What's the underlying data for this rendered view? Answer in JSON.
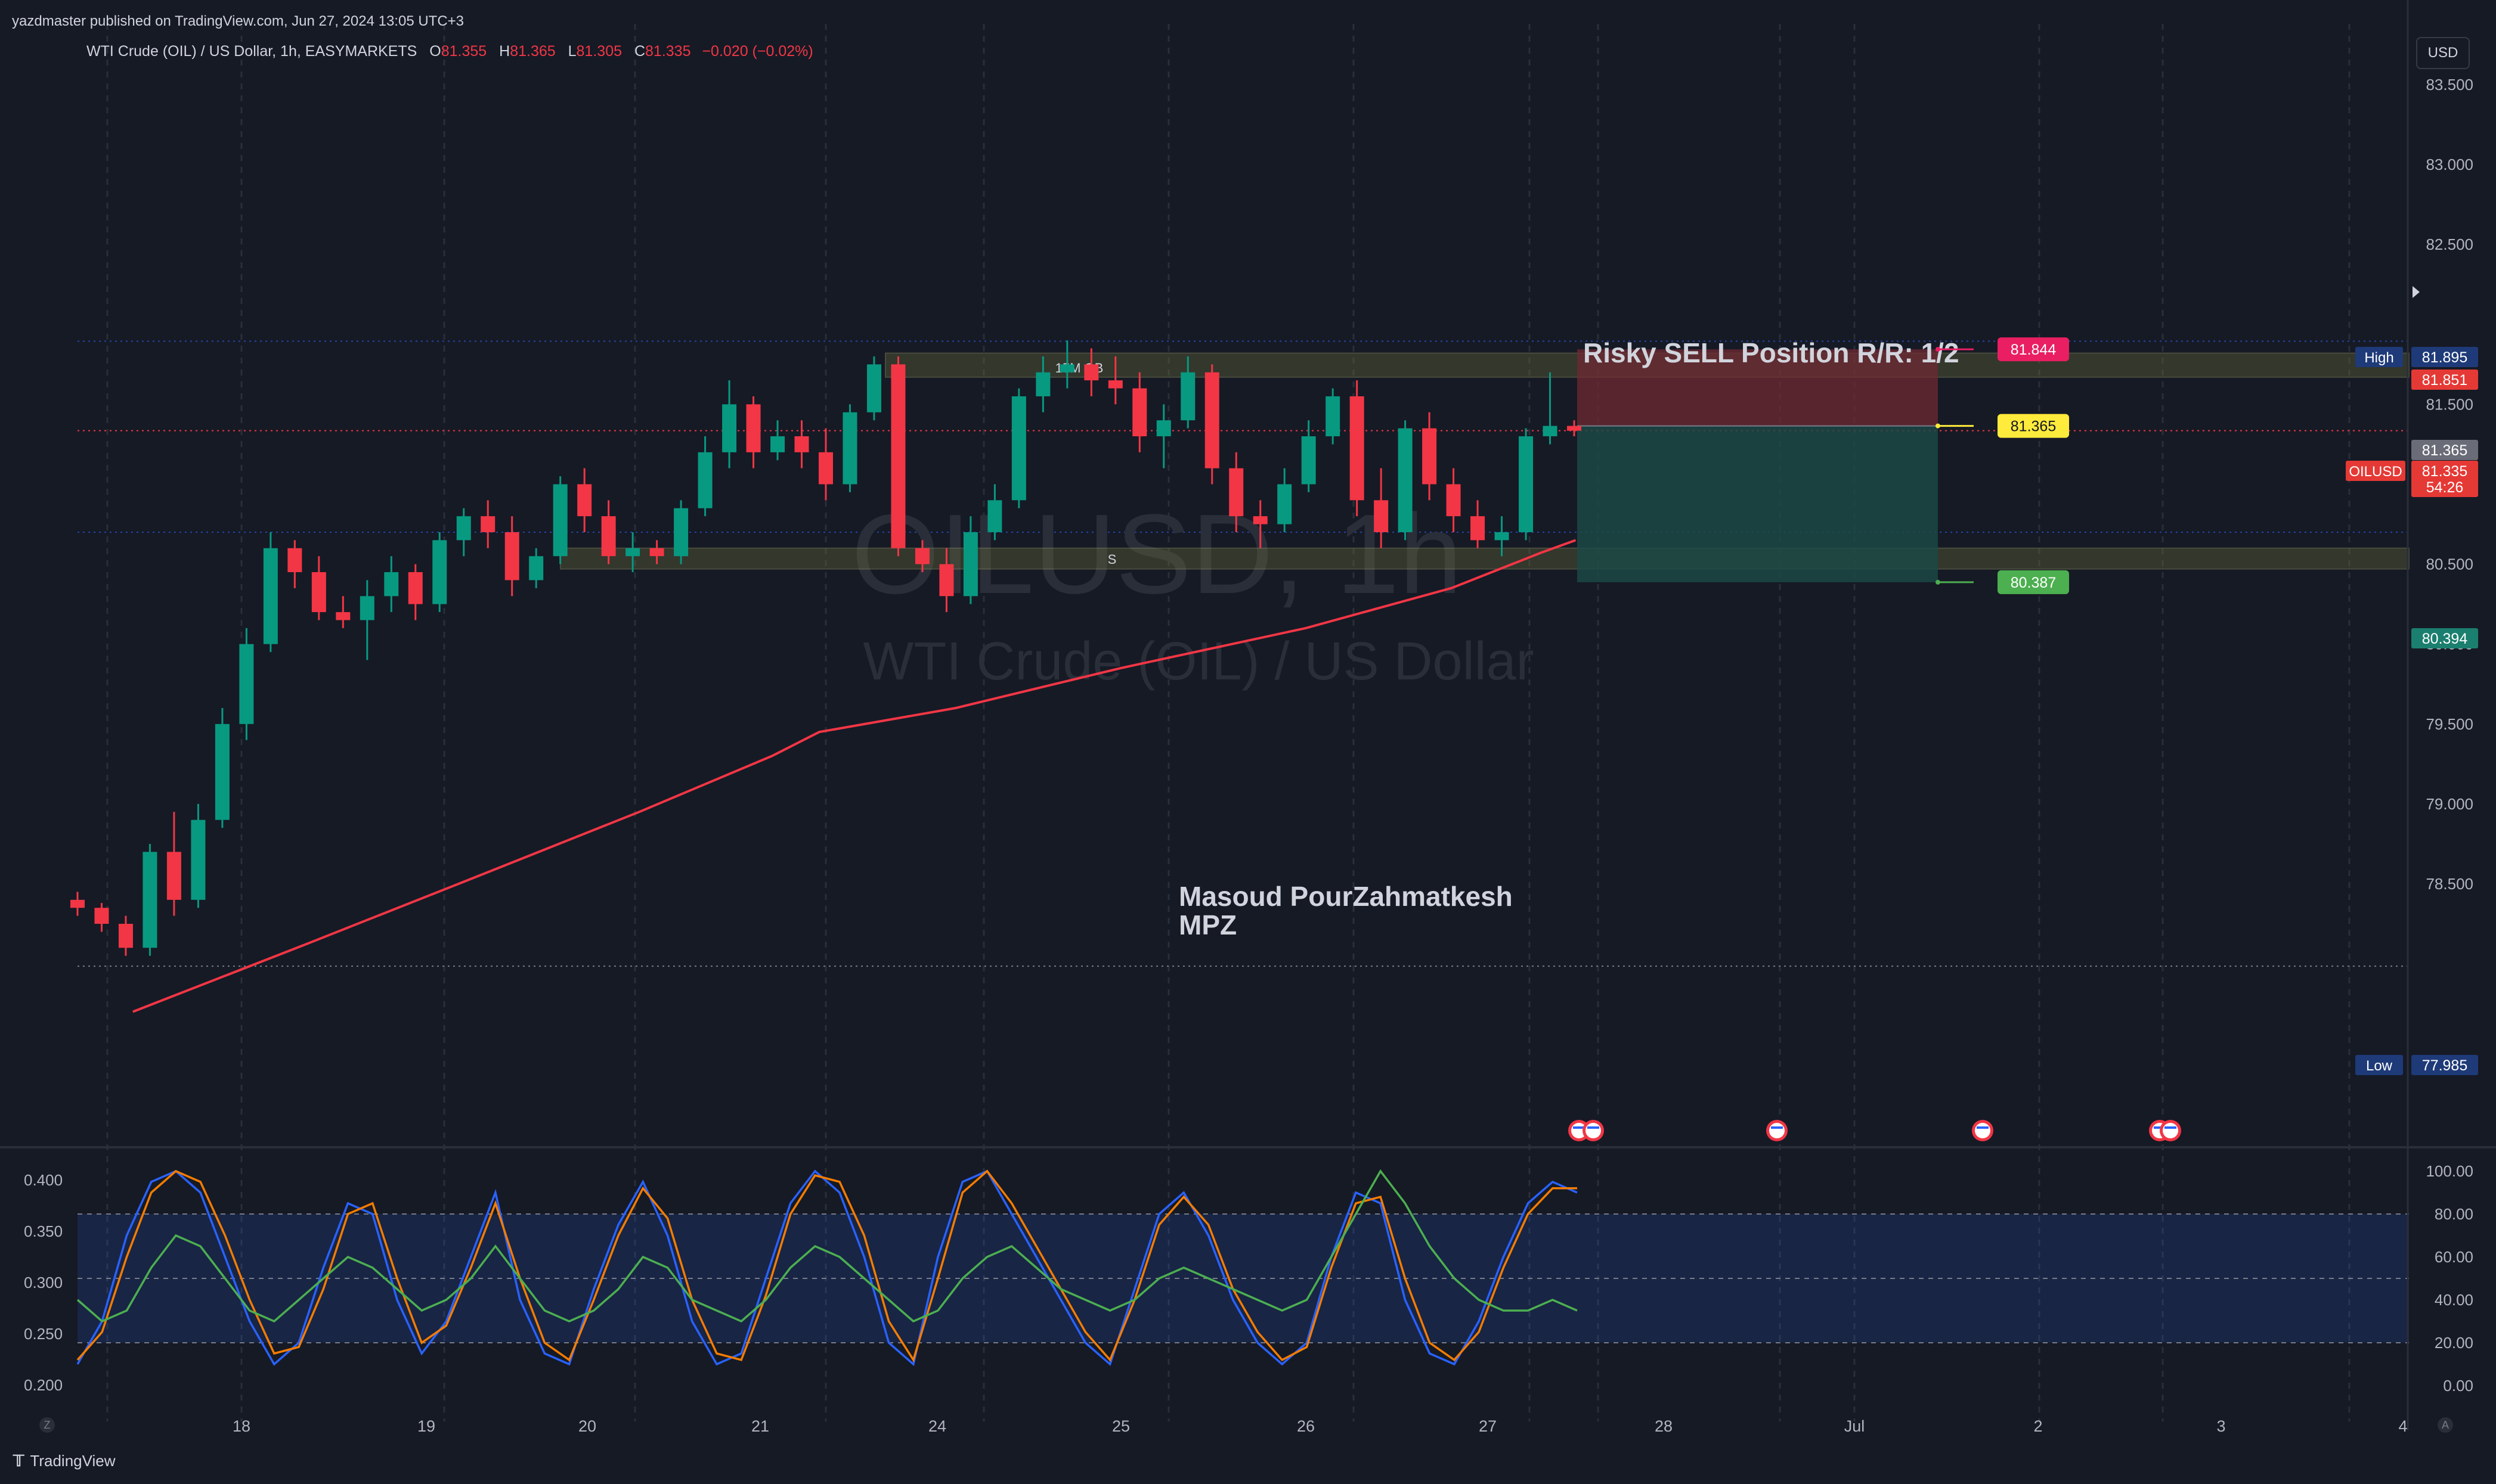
{
  "header": {
    "publisher_line": "yazdmaster published on TradingView.com, Jun 27, 2024 13:05 UTC+3"
  },
  "legend": {
    "symbol": "WTI Crude (OIL) / US Dollar, 1h, EASYMARKETS",
    "open_label": "O",
    "open": "81.355",
    "high_label": "H",
    "high": "81.365",
    "low_label": "L",
    "low": "81.305",
    "close_label": "C",
    "close": "81.335",
    "change": "−0.020 (−0.02%)"
  },
  "currency_button": "USD",
  "watermark": {
    "line1": "OILUSD, 1h",
    "line2": "WTI Crude (OIL) / US Dollar"
  },
  "annotations": {
    "position_title": "Risky SELL Position R/R: 1/2",
    "author_name": "Masoud PourZahmatkesh",
    "author_tag": "MPZ",
    "zone_label_top": "15M OB",
    "zone_label_bottom": "S"
  },
  "footer": {
    "brand": "TradingView",
    "axis_left_btn": "Z",
    "axis_right_btn": "A"
  },
  "colors": {
    "background": "#161a25",
    "bull": "#089981",
    "bear": "#f23645",
    "ma": "#f23645",
    "zone_fill": "#6b6e3a",
    "stop_zone": "#6f2a33",
    "target_zone": "#1b4a47",
    "osc_fast": "#2962ff",
    "osc_slow": "#f57c00",
    "osc_rsi": "#4caf50"
  },
  "chart_data": [
    {
      "type": "candlestick",
      "title": "WTI Crude (OIL) / US Dollar, 1h, EASYMARKETS",
      "x_tick_labels": [
        "18",
        "19",
        "20",
        "21",
        "24",
        "25",
        "26",
        "27",
        "28",
        "Jul",
        "2",
        "3",
        "4"
      ],
      "y_tick_labels": [
        "83.500",
        "83.000",
        "82.500",
        "81.500",
        "81.000",
        "80.500",
        "80.000",
        "79.500",
        "79.000",
        "78.500"
      ],
      "ylim": [
        77.7,
        83.7
      ],
      "grid": true,
      "price_labels": {
        "high": {
          "label": "High",
          "value": "81.895"
        },
        "low": {
          "label": "Low",
          "value": "77.985"
        },
        "stop": "81.851",
        "last_close": "81.365",
        "symbol_tag": "OILUSD",
        "current": "81.335",
        "countdown": "54:26",
        "target": "80.394"
      },
      "position_tool": {
        "entry": 81.365,
        "stop": 81.844,
        "target": 80.387,
        "entry_label": "81.365",
        "stop_label": "81.844",
        "target_label": "80.387"
      },
      "zones": [
        {
          "name": "15M OB",
          "from": 81.67,
          "to": 81.82
        },
        {
          "name": "S",
          "from": 80.47,
          "to": 80.6
        }
      ],
      "moving_average_trend": [
        [
          17.55,
          77.7
        ],
        [
          18.3,
          78.1
        ],
        [
          19.2,
          78.5
        ],
        [
          20.3,
          78.95
        ],
        [
          21.2,
          79.3
        ],
        [
          22.0,
          79.45
        ],
        [
          24.1,
          79.6
        ],
        [
          25.0,
          79.85
        ],
        [
          26.0,
          80.1
        ],
        [
          26.8,
          80.35
        ],
        [
          27.3,
          80.57
        ],
        [
          27.5,
          80.65
        ]
      ],
      "candles_ohlc": [
        [
          78.4,
          78.45,
          78.3,
          78.35
        ],
        [
          78.35,
          78.38,
          78.2,
          78.25
        ],
        [
          78.25,
          78.3,
          78.05,
          78.1
        ],
        [
          78.1,
          78.75,
          78.05,
          78.7
        ],
        [
          78.7,
          78.95,
          78.3,
          78.4
        ],
        [
          78.4,
          79.0,
          78.35,
          78.9
        ],
        [
          78.9,
          79.6,
          78.85,
          79.5
        ],
        [
          79.5,
          80.1,
          79.4,
          80.0
        ],
        [
          80.0,
          80.7,
          79.95,
          80.6
        ],
        [
          80.6,
          80.65,
          80.35,
          80.45
        ],
        [
          80.45,
          80.55,
          80.15,
          80.2
        ],
        [
          80.2,
          80.3,
          80.1,
          80.15
        ],
        [
          80.15,
          80.4,
          79.9,
          80.3
        ],
        [
          80.3,
          80.55,
          80.2,
          80.45
        ],
        [
          80.45,
          80.5,
          80.15,
          80.25
        ],
        [
          80.25,
          80.7,
          80.2,
          80.65
        ],
        [
          80.65,
          80.85,
          80.55,
          80.8
        ],
        [
          80.8,
          80.9,
          80.6,
          80.7
        ],
        [
          80.7,
          80.8,
          80.3,
          80.4
        ],
        [
          80.4,
          80.6,
          80.35,
          80.55
        ],
        [
          80.55,
          81.05,
          80.5,
          81.0
        ],
        [
          81.0,
          81.1,
          80.7,
          80.8
        ],
        [
          80.8,
          80.9,
          80.5,
          80.55
        ],
        [
          80.55,
          80.7,
          80.45,
          80.6
        ],
        [
          80.6,
          80.65,
          80.5,
          80.55
        ],
        [
          80.55,
          80.9,
          80.5,
          80.85
        ],
        [
          80.85,
          81.3,
          80.8,
          81.2
        ],
        [
          81.2,
          81.65,
          81.1,
          81.5
        ],
        [
          81.5,
          81.55,
          81.1,
          81.2
        ],
        [
          81.2,
          81.4,
          81.15,
          81.3
        ],
        [
          81.3,
          81.4,
          81.1,
          81.2
        ],
        [
          81.2,
          81.35,
          80.9,
          81.0
        ],
        [
          81.0,
          81.5,
          80.95,
          81.45
        ],
        [
          81.45,
          81.8,
          81.4,
          81.75
        ],
        [
          81.75,
          81.8,
          80.55,
          80.6
        ],
        [
          80.6,
          80.65,
          80.45,
          80.5
        ],
        [
          80.5,
          80.6,
          80.2,
          80.3
        ],
        [
          80.3,
          80.8,
          80.25,
          80.7
        ],
        [
          80.7,
          81.0,
          80.65,
          80.9
        ],
        [
          80.9,
          81.6,
          80.85,
          81.55
        ],
        [
          81.55,
          81.8,
          81.45,
          81.7
        ],
        [
          81.7,
          81.9,
          81.6,
          81.75
        ],
        [
          81.75,
          81.85,
          81.55,
          81.65
        ],
        [
          81.65,
          81.8,
          81.5,
          81.6
        ],
        [
          81.6,
          81.7,
          81.2,
          81.3
        ],
        [
          81.3,
          81.5,
          81.1,
          81.4
        ],
        [
          81.4,
          81.8,
          81.35,
          81.7
        ],
        [
          81.7,
          81.75,
          81.0,
          81.1
        ],
        [
          81.1,
          81.2,
          80.7,
          80.8
        ],
        [
          80.8,
          80.9,
          80.6,
          80.75
        ],
        [
          80.75,
          81.1,
          80.7,
          81.0
        ],
        [
          81.0,
          81.4,
          80.95,
          81.3
        ],
        [
          81.3,
          81.6,
          81.25,
          81.55
        ],
        [
          81.55,
          81.65,
          80.8,
          80.9
        ],
        [
          80.9,
          81.1,
          80.6,
          80.7
        ],
        [
          80.7,
          81.4,
          80.65,
          81.35
        ],
        [
          81.35,
          81.45,
          80.9,
          81.0
        ],
        [
          81.0,
          81.1,
          80.7,
          80.8
        ],
        [
          80.8,
          80.9,
          80.6,
          80.65
        ],
        [
          80.65,
          80.8,
          80.55,
          80.7
        ],
        [
          80.7,
          81.35,
          80.65,
          81.3
        ],
        [
          81.3,
          81.7,
          81.25,
          81.365
        ],
        [
          81.365,
          81.4,
          81.3,
          81.335
        ]
      ]
    },
    {
      "type": "line",
      "title": "Oscillator",
      "y_left_tick_labels": [
        "0.400",
        "0.350",
        "0.300",
        "0.250",
        "0.200"
      ],
      "y_right_tick_labels": [
        "100.00",
        "80.00",
        "60.00",
        "40.00",
        "20.00",
        "0.00"
      ],
      "band": [
        20,
        80
      ],
      "series": [
        {
          "values": [
            10,
            30,
            70,
            95,
            100,
            90,
            60,
            30,
            10,
            20,
            55,
            85,
            80,
            40,
            15,
            30,
            60,
            90,
            40,
            15,
            10,
            45,
            75,
            95,
            70,
            30,
            10,
            15,
            50,
            85,
            100,
            90,
            60,
            20,
            10,
            60,
            95,
            100,
            80,
            60,
            40,
            20,
            10,
            45,
            80,
            90,
            70,
            40,
            20,
            10,
            20,
            60,
            90,
            85,
            40,
            15,
            10,
            30,
            60,
            85,
            95,
            90
          ]
        },
        {
          "values": [
            12,
            25,
            60,
            90,
            100,
            95,
            70,
            40,
            15,
            18,
            45,
            80,
            85,
            50,
            20,
            28,
            55,
            85,
            50,
            20,
            12,
            40,
            70,
            92,
            78,
            40,
            15,
            12,
            42,
            80,
            98,
            95,
            70,
            30,
            12,
            50,
            90,
            100,
            85,
            65,
            45,
            25,
            12,
            40,
            75,
            88,
            75,
            45,
            25,
            12,
            18,
            55,
            85,
            88,
            50,
            20,
            12,
            25,
            55,
            80,
            92,
            92
          ]
        },
        {
          "values": [
            40,
            30,
            35,
            55,
            70,
            65,
            50,
            35,
            30,
            40,
            50,
            60,
            55,
            45,
            35,
            40,
            50,
            65,
            50,
            35,
            30,
            35,
            45,
            60,
            55,
            40,
            35,
            30,
            40,
            55,
            65,
            60,
            50,
            40,
            30,
            35,
            50,
            60,
            65,
            55,
            45,
            40,
            35,
            40,
            50,
            55,
            50,
            45,
            40,
            35,
            40,
            60,
            80,
            100,
            85,
            65,
            50,
            40,
            35,
            35,
            40,
            35
          ]
        }
      ]
    }
  ]
}
